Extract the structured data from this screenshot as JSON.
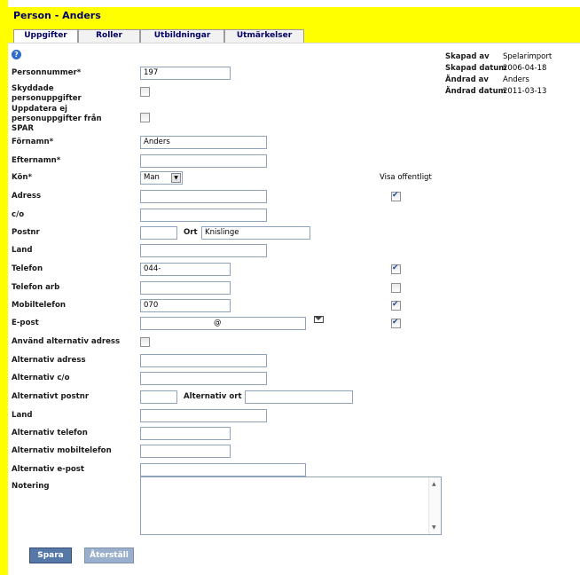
{
  "window": {
    "title": "Person - Anders"
  },
  "tabs": [
    {
      "label": "Uppgifter"
    },
    {
      "label": "Roller"
    },
    {
      "label": "Utbildningar"
    },
    {
      "label": "Utmärkelser"
    }
  ],
  "meta": {
    "skapad_av_label": "Skapad av",
    "skapad_av": "Spelarimport",
    "skapad_datum_label": "Skapad datum",
    "skapad_datum": "2006-04-18",
    "andrad_av_label": "Ändrad av",
    "andrad_av": "Anders",
    "andrad_datum_label": "Ändrad datum",
    "andrad_datum": "2011-03-13"
  },
  "visa_offentligt_label": "Visa offentligt",
  "form": {
    "personnummer": {
      "label": "Personnummer*",
      "value": "197"
    },
    "skyddade": {
      "label": "Skyddade personuppgifter",
      "checked": false
    },
    "uppdatera_ej": {
      "label": "Uppdatera ej personuppgifter från SPAR",
      "checked": false
    },
    "fornamn": {
      "label": "Förnamn*",
      "value": "Anders"
    },
    "efternamn": {
      "label": "Efternamn*",
      "value": ""
    },
    "kon": {
      "label": "Kön*",
      "value": "Man"
    },
    "adress": {
      "label": "Adress",
      "value": "",
      "public": true
    },
    "co": {
      "label": "c/o",
      "value": ""
    },
    "postnr": {
      "label": "Postnr",
      "value": ""
    },
    "ort": {
      "label": "Ort",
      "value": "Knislinge"
    },
    "land": {
      "label": "Land",
      "value": ""
    },
    "telefon": {
      "label": "Telefon",
      "value": "044-",
      "public": true
    },
    "telefon_arb": {
      "label": "Telefon arb",
      "value": "",
      "public": false
    },
    "mobiltelefon": {
      "label": "Mobiltelefon",
      "value": "070",
      "public": true
    },
    "epost": {
      "label": "E-post",
      "value": "@",
      "public": true
    },
    "anvand_alt": {
      "label": "Använd alternativ adress",
      "checked": false
    },
    "alt_adress": {
      "label": "Alternativ adress",
      "value": ""
    },
    "alt_co": {
      "label": "Alternativ c/o",
      "value": ""
    },
    "alt_postnr": {
      "label": "Alternativt postnr",
      "value": ""
    },
    "alt_ort": {
      "label": "Alternativ ort",
      "value": ""
    },
    "alt_land": {
      "label": "Land",
      "value": ""
    },
    "alt_telefon": {
      "label": "Alternativ telefon",
      "value": ""
    },
    "alt_mobil": {
      "label": "Alternativ mobiltelefon",
      "value": ""
    },
    "alt_epost": {
      "label": "Alternativ e-post",
      "value": ""
    },
    "notering": {
      "label": "Notering",
      "value": ""
    }
  },
  "buttons": {
    "save": "Spara",
    "reset": "Återställ"
  },
  "colors": {
    "accent": "#ffff00",
    "title": "#000066",
    "button": "#5578a6"
  },
  "icons": {
    "help": "help-icon",
    "mail": "mail-icon",
    "dropdown": "chevron-down-icon"
  }
}
